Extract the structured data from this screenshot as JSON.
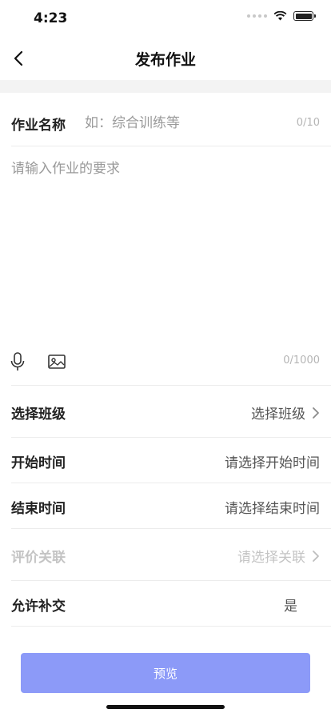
{
  "status_bar": {
    "time": "4:23",
    "icons": [
      "signal-dots-icon",
      "wifi-icon",
      "battery-icon"
    ]
  },
  "nav": {
    "title": "发布作业",
    "back_icon": "chevron-left-icon"
  },
  "form": {
    "name_label": "作业名称",
    "name_placeholder": "如：综合训练等",
    "name_counter": "0/10",
    "requirement_placeholder": "请输入作业的要求",
    "requirement_counter": "0/1000",
    "media_icons": [
      "microphone-icon",
      "image-icon"
    ]
  },
  "rows": [
    {
      "label": "选择班级",
      "value": "选择班级",
      "chevron": true,
      "disabled": false
    },
    {
      "label": "开始时间",
      "value": "请选择开始时间",
      "chevron": false,
      "disabled": false
    },
    {
      "label": "结束时间",
      "value": "请选择结束时间",
      "chevron": false,
      "disabled": false
    },
    {
      "label": "评价关联",
      "value": "请选择关联",
      "chevron": true,
      "disabled": true
    },
    {
      "label": "允许补交",
      "value": "是",
      "chevron": false,
      "disabled": false
    }
  ],
  "preview_button_label": "预览",
  "colors": {
    "accent": "#8c9af8",
    "placeholder": "#9a9a9a",
    "disabled": "#c4c4c4"
  }
}
